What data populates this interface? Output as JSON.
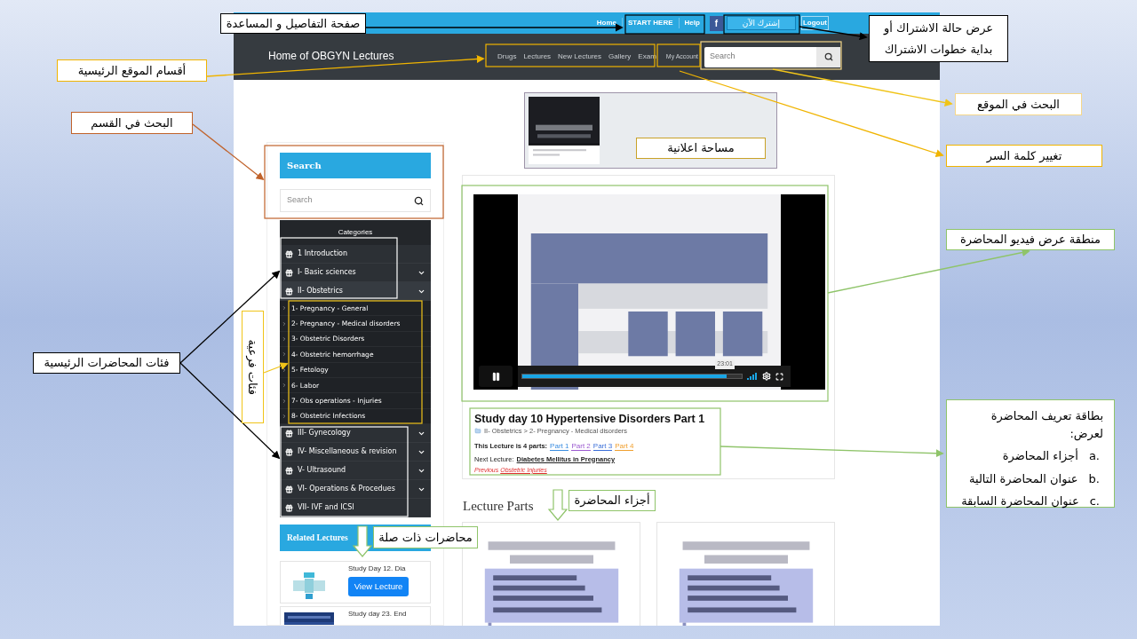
{
  "topbar": {
    "links": [
      {
        "label": "Home",
        "kind": "link"
      },
      {
        "label": "START HERE",
        "kind": "link"
      },
      {
        "label": "Help",
        "kind": "link"
      },
      {
        "label": "f",
        "kind": "social"
      },
      {
        "label": "إشترك الآن",
        "kind": "subscribe"
      },
      {
        "label": "Logout",
        "kind": "outlined"
      }
    ]
  },
  "header": {
    "site_title": "Home of OBGYN Lectures",
    "nav": [
      "Drugs",
      "Lectures",
      "New Lectures",
      "Gallery",
      "Exam"
    ],
    "account": "My Account",
    "search": {
      "placeholder": "Search"
    }
  },
  "sidebar": {
    "search": {
      "title": "Search",
      "placeholder": "Search"
    },
    "categories": {
      "title": "Categories",
      "items": [
        {
          "label": "1 Introduction",
          "kind": "leaf"
        },
        {
          "label": "I- Basic sciences",
          "kind": "group",
          "expanded": false
        },
        {
          "label": "II- Obstetrics",
          "kind": "group",
          "expanded": true,
          "children": [
            {
              "label": "1- Pregnancy - General"
            },
            {
              "label": "2- Pregnancy - Medical disorders"
            },
            {
              "label": "3- Obstetric Disorders"
            },
            {
              "label": "4- Obstetric hemorrhage"
            },
            {
              "label": "5- Fetology"
            },
            {
              "label": "6- Labor"
            },
            {
              "label": "7- Obs operations - Injuries"
            },
            {
              "label": "8- Obstetric Infections"
            }
          ]
        },
        {
          "label": "III- Gynecology",
          "kind": "group",
          "expanded": false
        },
        {
          "label": "IV- Miscellaneous & revision",
          "kind": "group",
          "expanded": false
        },
        {
          "label": "V- Ultrasound",
          "kind": "group",
          "expanded": false
        },
        {
          "label": "VI- Operations & Procedues",
          "kind": "group",
          "expanded": false
        },
        {
          "label": "VII- IVF and ICSI",
          "kind": "leaf"
        }
      ]
    },
    "related": {
      "title": "Related Lectures",
      "items": [
        {
          "title": "Study Day 12. Dia",
          "button": "View Lecture"
        },
        {
          "title": "Study day 23. End"
        }
      ]
    }
  },
  "video": {
    "kind": "picture",
    "progress": {
      "level": 0.93
    },
    "time": "23:01"
  },
  "lecture": {
    "title": "Study day 10 Hypertensive Disorders Part 1",
    "breadcrumb": "II- Obstetrics > 2- Pregnancy - Medical disorders",
    "parts_label": "This Lecture is 4 parts:",
    "parts": [
      {
        "label": "Part 1",
        "color": "#3b8de0"
      },
      {
        "label": "Part 2",
        "color": "#9b5ad0"
      },
      {
        "label": "Part 3",
        "color": "#3b6fd8"
      },
      {
        "label": "Part 4",
        "color": "#f0a030"
      }
    ],
    "next_label": "Next Lecture:",
    "next_link": "Diabetes Mellitus in Pregnancy",
    "previous_label": "Previous",
    "previous_link": "Obstetric Injuries"
  },
  "lecture_parts": {
    "title": "Lecture Parts"
  },
  "annotations": [
    {
      "kind": "label",
      "text": "عرض حالة الاشتراك أو بداية خطوات الاشتراك",
      "color": "#000000"
    },
    {
      "kind": "label",
      "text": "صفحة التفاصيل و المساعدة",
      "color": "#000000"
    },
    {
      "kind": "label",
      "text": "أقسام الموقع الرئيسية",
      "color": "#f0b400"
    },
    {
      "kind": "label",
      "text": "البحث في القسم",
      "color": "#c0622a"
    },
    {
      "kind": "label",
      "text": "البحث في الموقع",
      "color": "#f5d78a"
    },
    {
      "kind": "label",
      "text": "تغيير كلمة السر",
      "color": "#f0b400"
    },
    {
      "kind": "label",
      "text": "مساحة اعلانية",
      "color": "#c9a227"
    },
    {
      "kind": "label",
      "text": "منطقة عرض فيديو المحاضرة",
      "color": "#8fc46a"
    },
    {
      "kind": "list",
      "text": "بطاقة تعريف المحاضرة لعرض:",
      "color": "#8fc46a",
      "items": [
        {
          "marker": "a.",
          "text": "أجزاء المحاضرة"
        },
        {
          "marker": "b.",
          "text": "عنوان المحاضرة التالية"
        },
        {
          "marker": "c.",
          "text": "عنوان المحاضرة السابقة"
        }
      ]
    },
    {
      "kind": "label",
      "text": "فئات المحاضرات الرئيسية",
      "color": "#000000"
    },
    {
      "kind": "vertical",
      "text": "فئات فرعية",
      "color": "#f0c419"
    },
    {
      "kind": "label",
      "text": "أجزاء المحاضرة",
      "color": "#8fc46a"
    },
    {
      "kind": "label",
      "text": "محاضرات ذات صلة",
      "color": "#8fc46a"
    }
  ]
}
